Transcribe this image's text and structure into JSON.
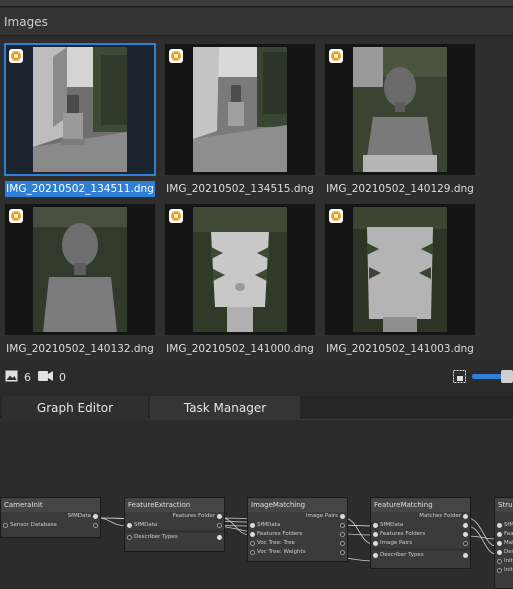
{
  "images_panel": {
    "title": "Images",
    "thumbnails": [
      {
        "filename": "IMG_20210502_134511.dng",
        "selected": true
      },
      {
        "filename": "IMG_20210502_134515.dng",
        "selected": false
      },
      {
        "filename": "IMG_20210502_140129.dng",
        "selected": false
      },
      {
        "filename": "IMG_20210502_140132.dng",
        "selected": false
      },
      {
        "filename": "IMG_20210502_141000.dng",
        "selected": false
      },
      {
        "filename": "IMG_20210502_141003.dng",
        "selected": false
      }
    ],
    "image_count": "6",
    "camera_count": "0",
    "selection_color": "#2f7fd6",
    "badge_color": "#f0a020"
  },
  "tabs": [
    {
      "label": "Graph Editor",
      "active": true
    },
    {
      "label": "Task Manager",
      "active": false
    }
  ],
  "graph": {
    "nodes": {
      "camera_init": {
        "title": "CameraInit",
        "outputs": [
          "SfMData"
        ],
        "inputs": [
          "Sensor Database"
        ]
      },
      "feature_extraction": {
        "title": "FeatureExtraction",
        "outputs": [
          "Features Folder"
        ],
        "inputs": [
          "SfMData",
          "Describer Types"
        ]
      },
      "image_matching": {
        "title": "ImageMatching",
        "outputs": [
          "Image Pairs"
        ],
        "inputs": [
          "SfMData",
          "Features Folders",
          "Voc Tree: Tree",
          "Voc Tree: Weights"
        ]
      },
      "feature_matching": {
        "title": "FeatureMatching",
        "outputs": [
          "Matches Folder"
        ],
        "inputs": [
          "SfMData",
          "Features Folders",
          "Image Pairs",
          "Describer Types"
        ]
      },
      "structure_from_motion": {
        "title": "Struc",
        "inputs": [
          "SfMI",
          "Feat",
          "Mat",
          "Des",
          "Initi",
          "Initi"
        ]
      }
    }
  }
}
